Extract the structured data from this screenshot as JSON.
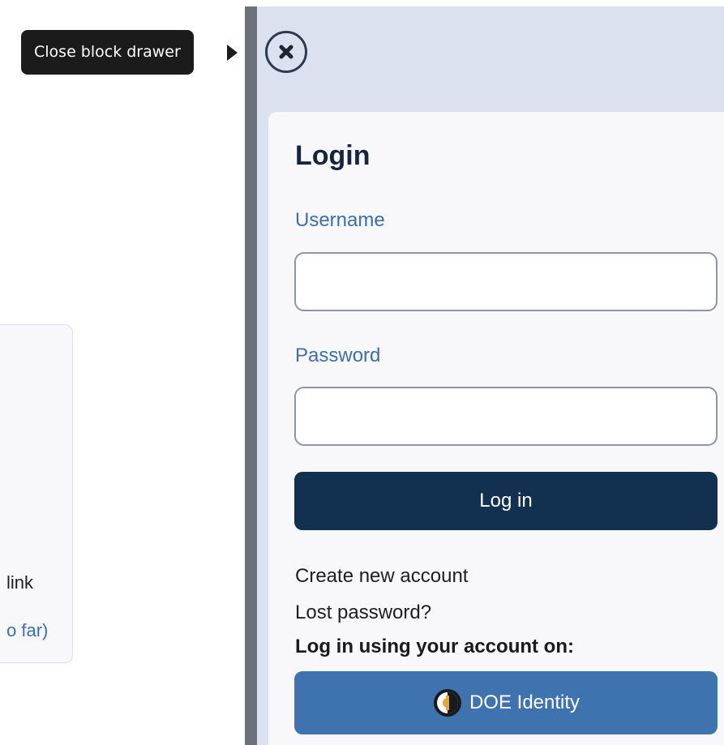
{
  "tooltip": {
    "text": "Close block drawer"
  },
  "background": {
    "link_text": "link",
    "far_text": "o far)"
  },
  "drawer": {
    "close_icon": "close-circle-icon",
    "login": {
      "title": "Login",
      "username_label": "Username",
      "username_value": "",
      "password_label": "Password",
      "password_value": "",
      "login_button": "Log in",
      "create_account": "Create new account",
      "lost_password": "Lost password?",
      "oauth_heading": "Log in using your account on:",
      "oauth_provider": "DOE Identity",
      "oauth_icon": "doe-identity-logo-icon"
    }
  },
  "colors": {
    "primary": "#12304f",
    "oauth": "#3f73b0",
    "drawer_bg": "#dbe1ee",
    "label": "#3f6fa8"
  }
}
